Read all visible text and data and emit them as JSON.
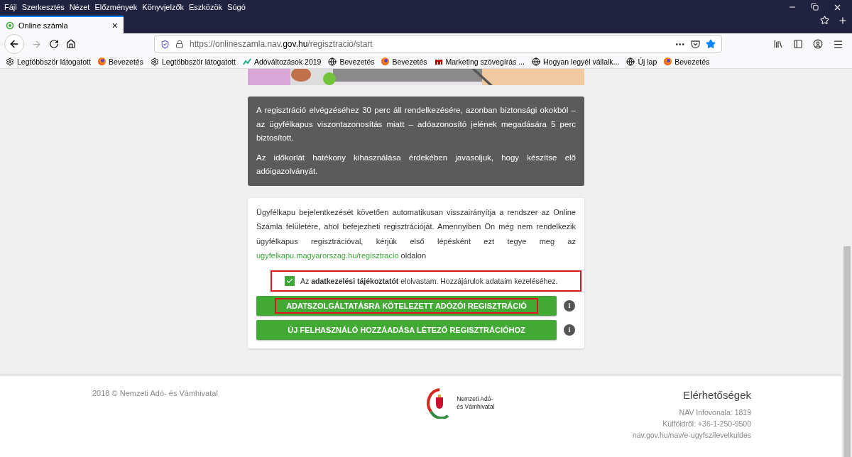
{
  "menu_bar": [
    "Fájl",
    "Szerkesztés",
    "Nézet",
    "Előzmények",
    "Könyvjelzők",
    "Eszközök",
    "Súgó"
  ],
  "tab": {
    "title": "Online számla",
    "selected": true,
    "close": "×"
  },
  "address_bar": {
    "prefix": "https://onlineszamla.nav.",
    "domain": "gov.hu",
    "path": "/regisztracio/start",
    "more": "•••",
    "starred": true
  },
  "bookmarks": [
    {
      "label": "Legtöbbször látogatott",
      "kind": "gear"
    },
    {
      "label": "Bevezetés",
      "kind": "firefox"
    },
    {
      "label": "Legtöbbször látogatott",
      "kind": "gear"
    },
    {
      "label": "Adóváltozások 2019",
      "kind": "chart"
    },
    {
      "label": "Bevezetés",
      "kind": "globe"
    },
    {
      "label": "Bevezetés",
      "kind": "firefox"
    },
    {
      "label": "Marketing szövegírás ...",
      "kind": "m"
    },
    {
      "label": "Hogyan legyél vállalk...",
      "kind": "globe"
    },
    {
      "label": "Új lap",
      "kind": "globe"
    },
    {
      "label": "Bevezetés",
      "kind": "firefox"
    }
  ],
  "notice": {
    "paragraphs": [
      "A regisztráció elvégzéséhez 30 perc áll rendelkezésére, azonban biztonsági okokból – az ügyfélkapus viszontazonosítás miatt – adóazonosító jelének megadására 5 perc biztosított.",
      "Az időkorlát hatékony kihasználása érdekében javasoljuk, hogy készítse elő adóigazolványát."
    ]
  },
  "card": {
    "text": "Ügyfélkapu bejelentkezését követően automatikusan visszairányítja a rendszer az Online Számla felületére, ahol befejezheti regisztrációját. Amennyiben Ön még nem rendelkezik ügyfélkapus regisztrációval, kérjük első lépésként ezt tegye meg az",
    "link": "ugyfelkapu.magyarorszag.hu/regisztracio",
    "text_after": "oldalon",
    "consent": {
      "text": "Az **adatkezelési tájékoztatót** elolvastam. Hozzájárulok adataim kezeléséhez.",
      "checked": true,
      "highlighted": true
    },
    "buttons": [
      {
        "label": "ADATSZOLGÁLTATÁSRA KÖTELEZETT ADÓZÓI REGISZTRÁCIÓ",
        "highlighted": true,
        "info": "i"
      },
      {
        "label": "ÚJ FELHASZNÁLÓ HOZZÁADÁSA LÉTEZŐ REGISZTRÁCIÓHOZ",
        "highlighted": false,
        "info": "i"
      }
    ]
  },
  "footer": {
    "copyright": "2018 © Nemzeti Adó- és Vámhivatal",
    "logo_lines": [
      "Nemzeti Adó-",
      "és Vámhivatal"
    ],
    "contact_title": "Elérhetőségek",
    "contact_lines": [
      "NAV Infovonala: 1819",
      "Külföldről: +36-1-250-9500",
      "nav.gov.hu/nav/e-ugyfsz/levelkuldes"
    ]
  }
}
